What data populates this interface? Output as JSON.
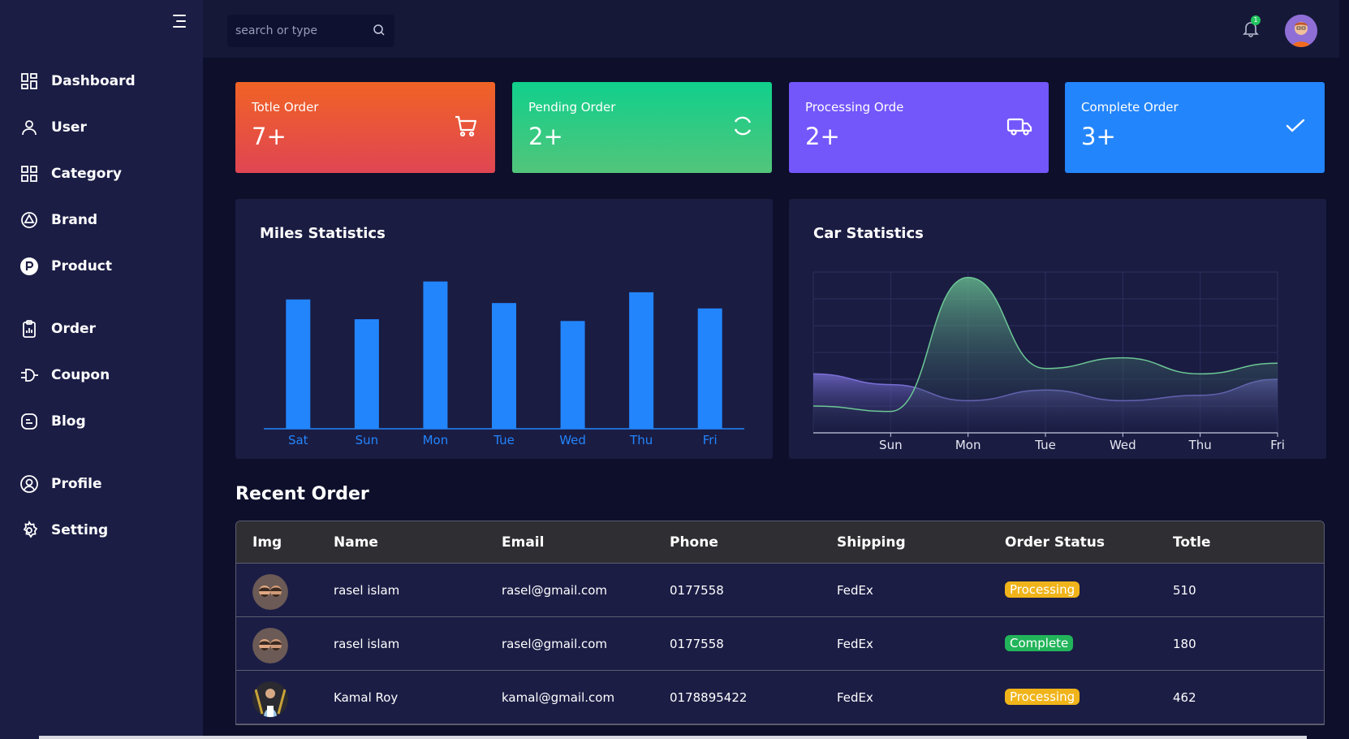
{
  "sidebar": {
    "items": [
      {
        "label": "Dashboard",
        "icon": "dashboard-grid-icon"
      },
      {
        "label": "User",
        "icon": "user-icon"
      },
      {
        "label": "Category",
        "icon": "category-grid-icon"
      },
      {
        "label": "Brand",
        "icon": "brand-icon"
      },
      {
        "label": "Product",
        "icon": "product-p-icon"
      },
      {
        "label": "Order",
        "icon": "clipboard-icon"
      },
      {
        "label": "Coupon",
        "icon": "coupon-icon"
      },
      {
        "label": "Blog",
        "icon": "blog-icon"
      },
      {
        "label": "Profile",
        "icon": "profile-circle-icon"
      },
      {
        "label": "Setting",
        "icon": "gear-icon"
      }
    ]
  },
  "topbar": {
    "search_placeholder": "search or type",
    "notification_count": "1"
  },
  "cards": [
    {
      "title": "Totle Order",
      "value": "7+",
      "icon": "cart-icon",
      "color": "#f06325"
    },
    {
      "title": "Pending Order",
      "value": "2+",
      "icon": "refresh-icon",
      "color": "#10d08c"
    },
    {
      "title": "Processing Orde",
      "value": "2+",
      "icon": "truck-icon",
      "color": "#7357fb"
    },
    {
      "title": "Complete Order",
      "value": "3+",
      "icon": "check-icon",
      "color": "#2385fc"
    }
  ],
  "chart_data": [
    {
      "type": "bar",
      "title": "Miles Statistics",
      "categories": [
        "Sat",
        "Sun",
        "Mon",
        "Tue",
        "Wed",
        "Thu",
        "Fri"
      ],
      "values": [
        72,
        61,
        82,
        70,
        60,
        76,
        67
      ],
      "color": "#2385fc"
    },
    {
      "type": "area",
      "title": "Car Statistics",
      "x": [
        "Sun",
        "Mon",
        "Tue",
        "Wed",
        "Thu",
        "Fri"
      ],
      "series": [
        {
          "values": [
            4,
            29,
            12,
            14,
            11,
            13
          ],
          "color": "#6cc795"
        },
        {
          "values": [
            9,
            6,
            8,
            6,
            7,
            10
          ],
          "color": "#7a6fd6"
        }
      ]
    }
  ],
  "recent_order": {
    "title": "Recent Order",
    "columns": [
      "Img",
      "Name",
      "Email",
      "Phone",
      "Shipping",
      "Order Status",
      "Totle"
    ],
    "rows": [
      {
        "name": "rasel islam",
        "email": "rasel@gmail.com",
        "phone": "0177558",
        "shipping": "FedEx",
        "status": "Processing",
        "total": "510"
      },
      {
        "name": "rasel islam",
        "email": "rasel@gmail.com",
        "phone": "0177558",
        "shipping": "FedEx",
        "status": "Complete",
        "total": "180"
      },
      {
        "name": "Kamal Roy",
        "email": "kamal@gmail.com",
        "phone": "0178895422",
        "shipping": "FedEx",
        "status": "Processing",
        "total": "462"
      }
    ]
  },
  "colors": {
    "sidebar_bg": "#1b1d45",
    "page_bg": "#0d0f2b",
    "processing": "#f0b41a",
    "complete": "#22b45a"
  }
}
